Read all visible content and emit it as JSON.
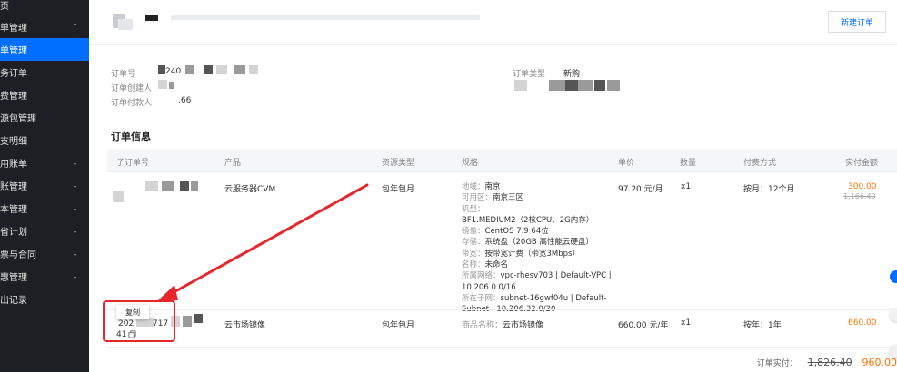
{
  "sidebar": {
    "items": [
      {
        "label": "主页",
        "active": false,
        "chevron": false
      },
      {
        "label": "订单管理",
        "active": false,
        "chevron": true
      },
      {
        "label": "订单管理",
        "active": true,
        "chevron": false
      },
      {
        "label": "服务订单",
        "active": false,
        "chevron": false
      },
      {
        "label": "续费管理",
        "active": false,
        "chevron": false
      },
      {
        "label": "资源包管理",
        "active": false,
        "chevron": false
      },
      {
        "label": "收支明细",
        "active": false,
        "chevron": false
      },
      {
        "label": "费用账单",
        "active": false,
        "chevron": true
      },
      {
        "label": "分账管理",
        "active": false,
        "chevron": true
      },
      {
        "label": "成本管理",
        "active": false,
        "chevron": true
      },
      {
        "label": "节省计划",
        "active": false,
        "chevron": true
      },
      {
        "label": "发票与合同",
        "active": false,
        "chevron": true
      },
      {
        "label": "优惠管理",
        "active": false,
        "chevron": true
      },
      {
        "label": "导出记录",
        "active": false,
        "chevron": false
      }
    ]
  },
  "header": {
    "new_order_button": "新建订单"
  },
  "order_info": {
    "order_no_label": "订单号",
    "order_no_value": "240",
    "creator_label": "订单创建人",
    "payer_label": "订单付款人",
    "payer_value": ".66",
    "type_label": "订单类型",
    "type_value": "新购"
  },
  "section": {
    "title": "订单信息"
  },
  "table": {
    "headers": [
      "子订单号",
      "产品",
      "资源类型",
      "规格",
      "单价",
      "数量",
      "付费方式",
      "实付金额"
    ],
    "rows": [
      {
        "product": "云服务器CVM",
        "resource_type": "包年包月",
        "spec": [
          {
            "k": "地域：",
            "v": "南京"
          },
          {
            "k": "可用区：",
            "v": "南京三区"
          },
          {
            "k": "机型：",
            "v": "BF1.MEDIUM2（2核CPU、2G内存）"
          },
          {
            "k": "镜像：",
            "v": "CentOS 7.9 64位"
          },
          {
            "k": "存储：",
            "v": "系统盘（20GB 高性能云硬盘）"
          },
          {
            "k": "带宽：",
            "v": "按带宽计费（带宽3Mbps）"
          },
          {
            "k": "名称：",
            "v": "未命名"
          },
          {
            "k": "所属网络：",
            "v": "vpc-rhesv703 | Default-VPC | 10.206.0.0/16"
          },
          {
            "k": "所在子网：",
            "v": "subnet-16gwf04u | Default-Subnet | 10.206.32.0/20"
          }
        ],
        "unit_price": "97.20 元/月",
        "quantity": "x1",
        "billing": "按月：12个月",
        "paid": "300.00",
        "original": "1,166.40"
      },
      {
        "sub_order_prefix": "202",
        "sub_order_mid": "717",
        "sub_order_suffix": "41",
        "product": "云市场镜像",
        "resource_type": "包年包月",
        "spec_label": "商品名称：",
        "spec_value": "云市场镜像",
        "unit_price": "660.00 元/年",
        "quantity": "x1",
        "billing": "按年：1年",
        "paid": "660.00"
      }
    ]
  },
  "tooltip": {
    "copy_label": "复制"
  },
  "total": {
    "label": "订单实付：",
    "original": "1,826.40",
    "paid": "960.00"
  },
  "colors": {
    "accent": "#006eff",
    "price": "#ff7200",
    "annotation": "#e7262b",
    "sidebar_bg": "#1d1f24"
  }
}
